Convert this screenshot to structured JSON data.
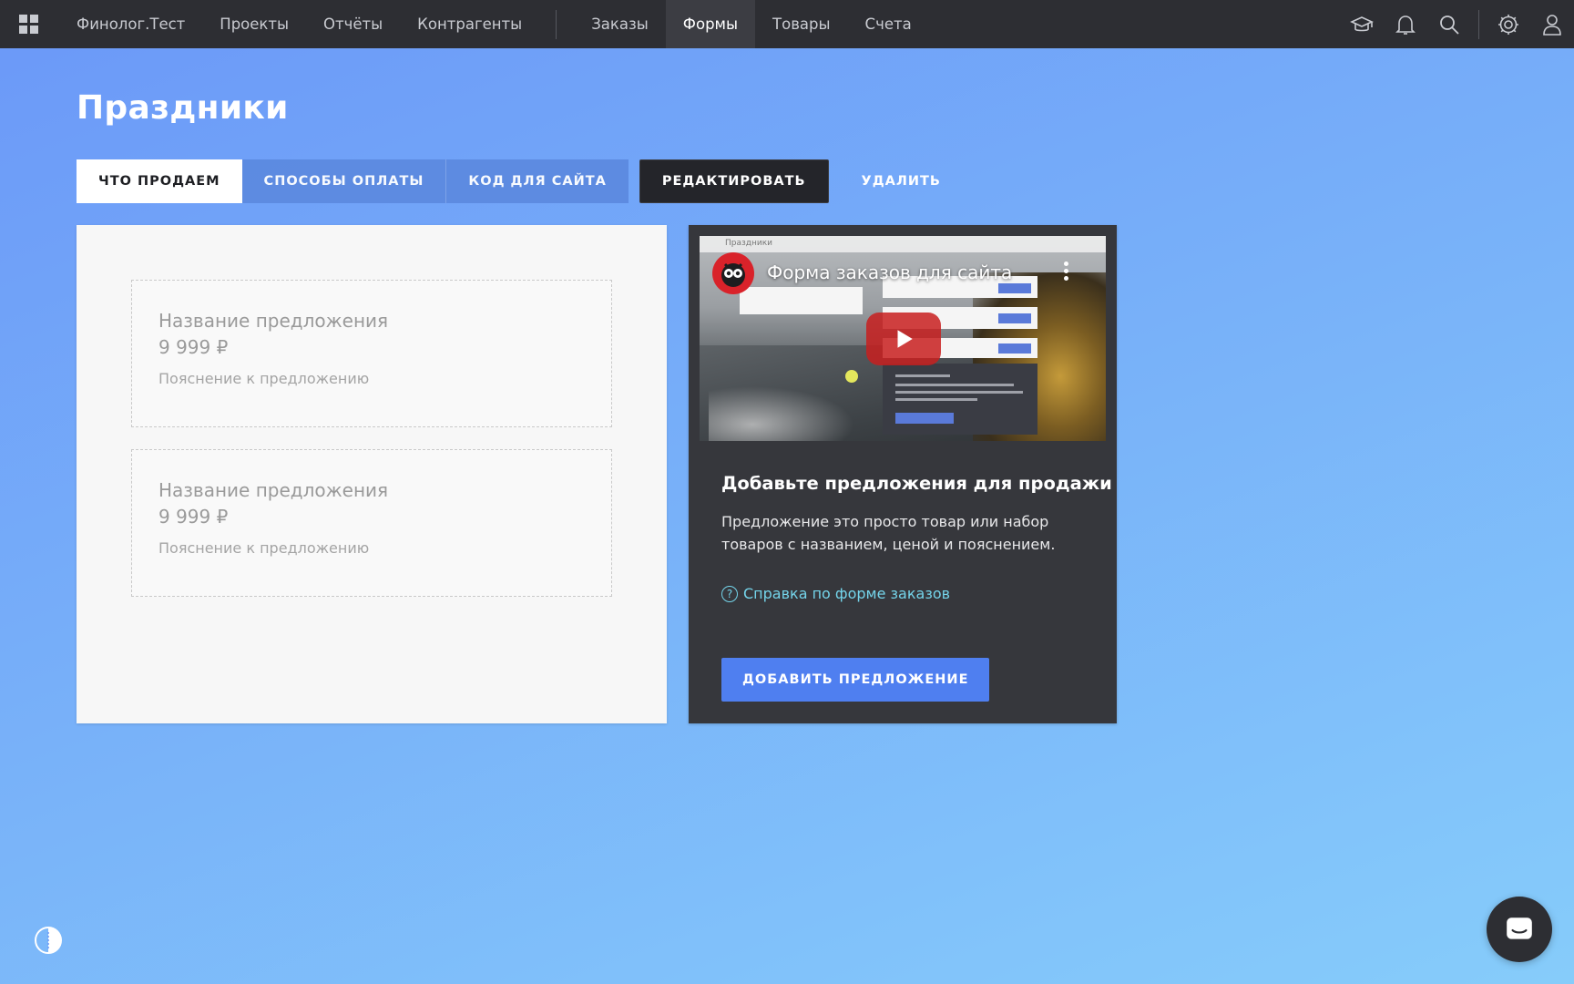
{
  "nav": {
    "items": [
      {
        "label": "Финолог.Тест",
        "active": false
      },
      {
        "label": "Проекты",
        "active": false
      },
      {
        "label": "Отчёты",
        "active": false
      },
      {
        "label": "Контрагенты",
        "active": false
      },
      {
        "label": "Заказы",
        "active": false
      },
      {
        "label": "Формы",
        "active": true
      },
      {
        "label": "Товары",
        "active": false
      },
      {
        "label": "Счета",
        "active": false
      }
    ],
    "icons": [
      "apps-grid-icon",
      "graduation-cap-icon",
      "bell-icon",
      "search-icon",
      "gear-icon",
      "user-icon"
    ]
  },
  "page": {
    "title": "Праздники"
  },
  "tabs": {
    "what_we_sell": "Что продаем",
    "payment_methods": "Способы оплаты",
    "site_code": "Код для сайта",
    "edit": "Редактировать",
    "delete": "Удалить"
  },
  "offers": [
    {
      "name": "Название предложения",
      "price": "9 999 ₽",
      "description": "Пояснение к предложению"
    },
    {
      "name": "Название предложения",
      "price": "9 999 ₽",
      "description": "Пояснение к предложению"
    }
  ],
  "video": {
    "title": "Форма заказов для сайта",
    "mock_breadcrumb": "Праздники"
  },
  "info": {
    "heading": "Добавьте предложения для продажи",
    "text": "Предложение это просто товар или набор товаров с названием, ценой и пояснением.",
    "help_link": "Справка по форме заказов",
    "add_button": "Добавить предложение"
  },
  "colors": {
    "topbar": "#2d2e33",
    "accent_blue": "#4f7ff0",
    "help_link": "#74d4ea",
    "card_dark": "#36373c"
  }
}
